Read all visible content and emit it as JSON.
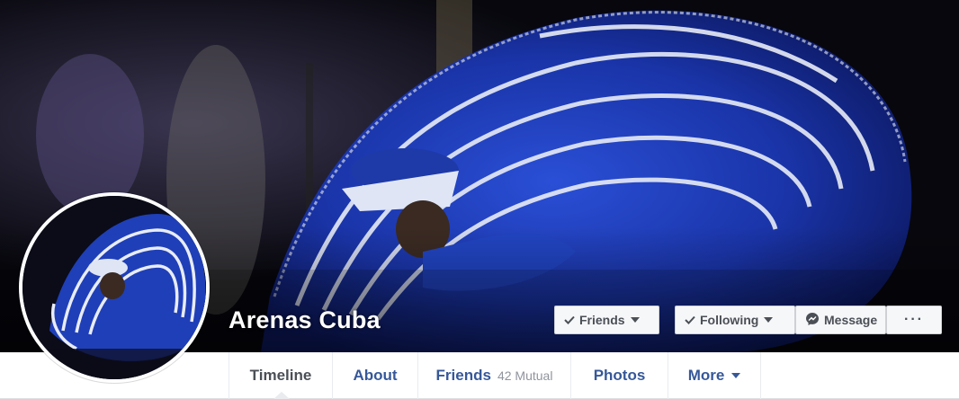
{
  "profile": {
    "name": "Arenas Cuba"
  },
  "actions": {
    "friends_label": "Friends",
    "following_label": "Following",
    "message_label": "Message",
    "more_label": "···"
  },
  "tabs": [
    {
      "label": "Timeline",
      "active": true
    },
    {
      "label": "About"
    },
    {
      "label": "Friends",
      "sub": "42 Mutual"
    },
    {
      "label": "Photos"
    },
    {
      "label": "More"
    }
  ],
  "icons": {
    "friends": "check-icon",
    "following": "check-icon",
    "message": "messenger-icon",
    "more": "ellipsis-icon"
  },
  "colors": {
    "link": "#365899",
    "dress": "#1f3fb8",
    "button_bg": "#f6f7f9"
  }
}
